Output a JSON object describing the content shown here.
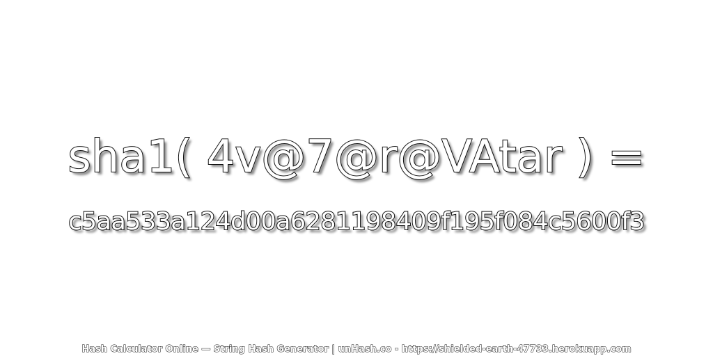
{
  "expression": "sha1( 4v@7@r@VAtar ) =",
  "hash_value": "c5aa533a124d00a6281198409f195f084c5600f3",
  "footer": "Hash Calculator Online — String Hash Generator | unHash.co - https://shielded-earth-47733.herokuapp.com"
}
